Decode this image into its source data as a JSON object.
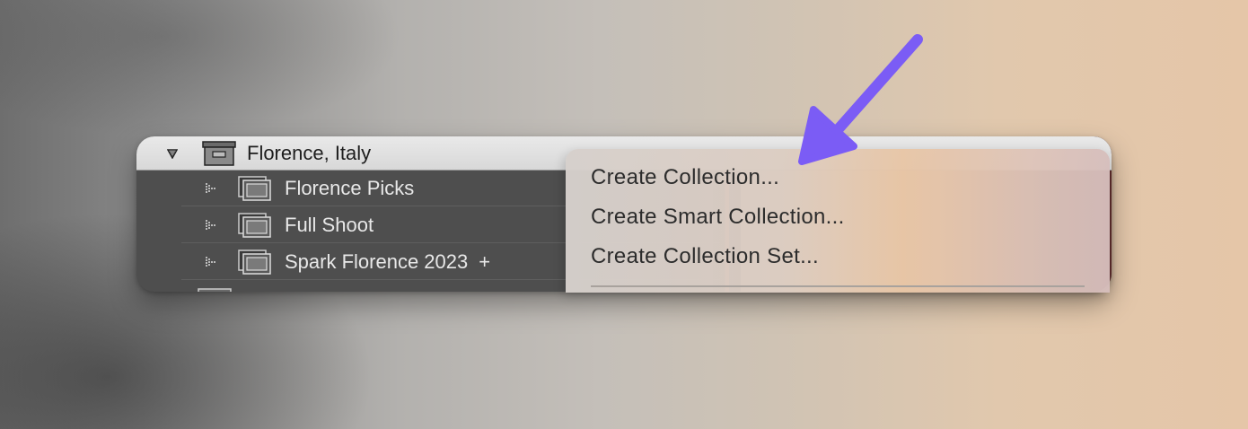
{
  "collections_panel": {
    "parent_set": {
      "label": "Florence, Italy",
      "icon": "collection-set-icon",
      "expanded": true
    },
    "children": [
      {
        "label": "Florence Picks",
        "icon": "collection-icon"
      },
      {
        "label": "Full Shoot",
        "icon": "collection-icon"
      },
      {
        "label": "Spark Florence 2023",
        "icon": "collection-icon",
        "target_marker": "+"
      }
    ]
  },
  "context_menu": {
    "items": [
      {
        "label": "Create Collection..."
      },
      {
        "label": "Create Smart Collection..."
      },
      {
        "label": "Create Collection Set..."
      }
    ]
  },
  "annotation": {
    "icon": "pointer-arrow-icon",
    "color": "#7b5cf5"
  }
}
